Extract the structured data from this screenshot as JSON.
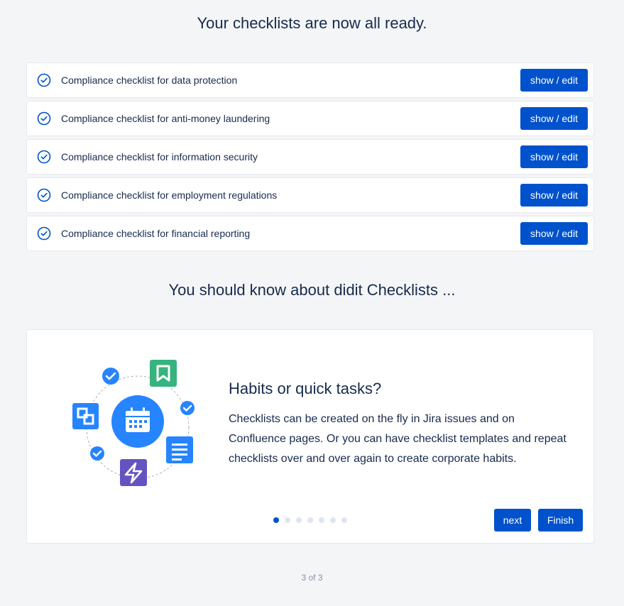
{
  "header": {
    "title": "Your checklists are now all ready."
  },
  "checklists": [
    {
      "label": "Compliance checklist for data protection",
      "action": "show / edit"
    },
    {
      "label": "Compliance checklist for anti-money laundering",
      "action": "show / edit"
    },
    {
      "label": "Compliance checklist for information security",
      "action": "show / edit"
    },
    {
      "label": "Compliance checklist for employment regulations",
      "action": "show / edit"
    },
    {
      "label": "Compliance checklist for financial reporting",
      "action": "show / edit"
    }
  ],
  "info": {
    "heading": "You should know about didit Checklists ...",
    "card": {
      "title": "Habits or quick tasks?",
      "text": "Checklists can be created on the fly in Jira issues and on Confluence pages. Or you can have checklist templates and repeat checklists over and over again to create corporate habits.",
      "slide_count": 7,
      "active_slide": 0,
      "next_label": "next",
      "finish_label": "Finish"
    }
  },
  "footer": {
    "pager": "3 of 3"
  },
  "icons": {
    "row_check": "check-circle-icon",
    "illustration": [
      "calendar-icon",
      "bookmark-icon",
      "document-icon",
      "lightning-icon",
      "squares-icon",
      "check-badge-icon"
    ]
  },
  "colors": {
    "primary": "#0052cc",
    "text": "#172b4d",
    "background": "#f4f5f7",
    "green": "#36b37e",
    "purple": "#6554c0",
    "blue_light": "#2684ff"
  }
}
